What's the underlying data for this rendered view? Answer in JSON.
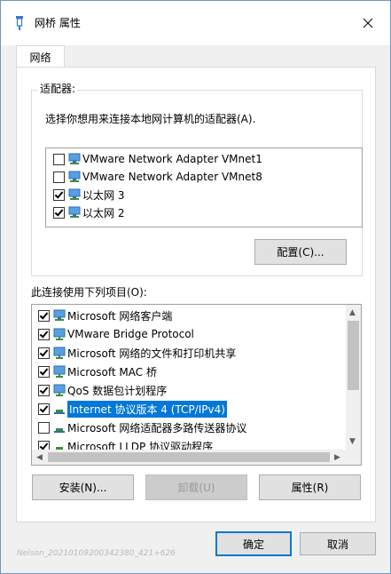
{
  "window": {
    "title": "网桥 属性",
    "close_icon": "close-icon"
  },
  "tabs": [
    {
      "label": "网络"
    }
  ],
  "adapters": {
    "legend": "适配器:",
    "prompt": "选择你想用来连接本地网计算机的适配器(A).",
    "items": [
      {
        "label": "VMware Network Adapter VMnet1",
        "checked": false
      },
      {
        "label": "VMware Network Adapter VMnet8",
        "checked": false
      },
      {
        "label": "以太网 3",
        "checked": true
      },
      {
        "label": "以太网 2",
        "checked": true
      }
    ],
    "configure_label": "配置(C)..."
  },
  "components": {
    "label": "此连接使用下列项目(O):",
    "items": [
      {
        "label": "Microsoft 网络客户端",
        "checked": true,
        "icon": "network-client-icon"
      },
      {
        "label": "VMware Bridge Protocol",
        "checked": true,
        "icon": "network-service-icon"
      },
      {
        "label": "Microsoft 网络的文件和打印机共享",
        "checked": true,
        "icon": "network-service-icon"
      },
      {
        "label": "Microsoft MAC 桥",
        "checked": true,
        "icon": "network-service-icon"
      },
      {
        "label": "QoS 数据包计划程序",
        "checked": true,
        "icon": "network-service-icon"
      },
      {
        "label": "Internet 协议版本 4 (TCP/IPv4)",
        "checked": true,
        "icon": "protocol-icon",
        "selected": true
      },
      {
        "label": "Microsoft 网络适配器多路传送器协议",
        "checked": false,
        "icon": "protocol-icon"
      },
      {
        "label": "Microsoft LLDP 协议驱动程序",
        "checked": true,
        "icon": "protocol-icon"
      }
    ],
    "install_label": "安装(N)...",
    "uninstall_label": "卸载(U)",
    "properties_label": "属性(R)"
  },
  "footer": {
    "ok_label": "确定",
    "cancel_label": "取消"
  },
  "watermark": "Nelson_20210109200342380_421+626",
  "colors": {
    "accent": "#0078d7",
    "window_bg": "#f0f0f0",
    "panel_bg": "#ffffff"
  }
}
